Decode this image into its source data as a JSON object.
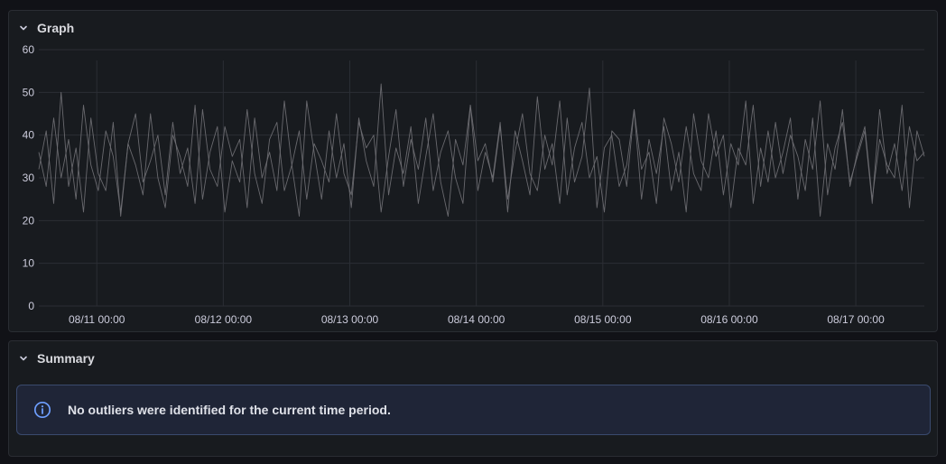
{
  "graph_panel": {
    "title": "Graph"
  },
  "summary_panel": {
    "title": "Summary",
    "alert_text": "No outliers were identified for the current time period."
  },
  "icons": {
    "collapse": "chevron-down-icon",
    "info": "info-circle-icon"
  },
  "colors": {
    "series": "#6e6e73",
    "grid": "#2b2e34",
    "alert_accent": "#6e9fff"
  },
  "chart_data": {
    "type": "line",
    "title": "",
    "xlabel": "",
    "ylabel": "",
    "ylim": [
      0,
      60
    ],
    "yticks": [
      0,
      10,
      20,
      30,
      40,
      50,
      60
    ],
    "xticks": [
      "08/11 00:00",
      "08/12 00:00",
      "08/13 00:00",
      "08/14 00:00",
      "08/15 00:00",
      "08/16 00:00",
      "08/17 00:00"
    ],
    "x_range": [
      "08/10 13:00",
      "08/17 13:00"
    ],
    "grid": true,
    "legend": "none",
    "series": [
      {
        "x_start": "08/10 13:00",
        "step_hours": 2,
        "values": [
          32,
          41,
          24,
          50,
          28,
          37,
          22,
          44,
          31,
          27,
          43,
          21,
          38,
          33,
          26,
          45,
          30,
          23,
          40,
          35,
          28,
          47,
          25,
          36,
          42,
          22,
          34,
          29,
          46,
          31,
          24,
          39,
          43,
          27,
          33,
          21,
          48,
          36,
          25,
          41,
          30,
          38,
          23,
          44,
          34,
          28,
          52,
          26,
          37,
          31,
          42,
          24,
          35,
          45,
          29,
          21,
          39,
          33,
          47,
          27,
          36,
          30,
          43,
          22,
          41,
          34,
          26,
          49,
          32,
          38,
          24,
          44,
          29,
          35,
          51,
          23,
          37,
          40,
          28,
          33,
          46,
          25,
          39,
          31,
          42,
          27,
          36,
          22,
          45,
          34,
          30,
          41,
          26,
          38,
          33,
          48,
          24,
          37,
          29,
          43,
          31,
          40,
          35,
          27,
          44,
          21,
          38,
          32,
          46,
          28,
          36,
          42,
          25,
          39,
          33,
          30,
          47,
          23,
          41,
          35
        ]
      },
      {
        "x_start": "08/10 13:00",
        "step_hours": 2,
        "values": [
          36,
          28,
          44,
          30,
          39,
          25,
          47,
          33,
          27,
          41,
          35,
          22,
          38,
          45,
          29,
          34,
          40,
          26,
          43,
          31,
          37,
          24,
          46,
          32,
          28,
          42,
          35,
          39,
          23,
          44,
          30,
          36,
          27,
          48,
          33,
          41,
          25,
          38,
          34,
          29,
          45,
          31,
          26,
          43,
          37,
          40,
          22,
          35,
          46,
          28,
          39,
          32,
          44,
          27,
          36,
          41,
          30,
          24,
          47,
          34,
          38,
          29,
          42,
          25,
          36,
          45,
          31,
          27,
          40,
          33,
          48,
          26,
          37,
          43,
          30,
          35,
          22,
          41,
          39,
          28,
          46,
          32,
          36,
          24,
          44,
          38,
          29,
          42,
          31,
          27,
          45,
          35,
          40,
          23,
          37,
          33,
          47,
          28,
          41,
          30,
          36,
          44,
          25,
          39,
          32,
          48,
          26,
          37,
          43,
          29,
          35,
          41,
          24,
          46,
          31,
          38,
          27,
          42,
          34,
          36
        ]
      }
    ]
  }
}
